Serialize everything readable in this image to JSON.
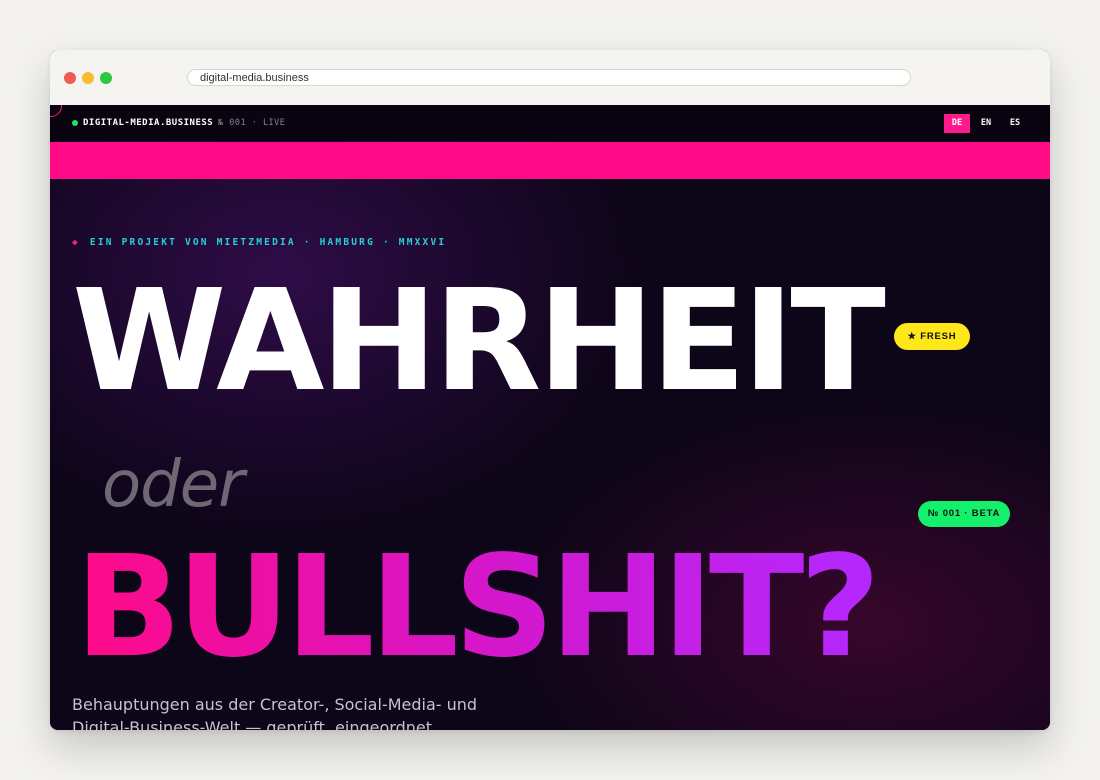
{
  "browser": {
    "url": "digital-media.business"
  },
  "nav": {
    "brand": "DIGITAL-MEDIA.BUSINESS",
    "issue": "№ 001 · LIVE",
    "languages": [
      "DE",
      "EN",
      "ES"
    ],
    "active_language": "DE"
  },
  "hero": {
    "kicker_symbol": "◆",
    "kicker": "EIN PROJEKT VON MIETZMEDIA · HAMBURG · MMXXVI",
    "title_line1": "WAHRHEIT",
    "title_line2": "oder",
    "title_line3": "BULLSHIT?",
    "badge_fresh": "★ FRESH",
    "badge_beta": "№ 001 · BETA",
    "lede": "Behauptungen aus der Creator-, Social-Media- und Digital-Business-Welt — geprüft, eingeordnet."
  },
  "colors": {
    "accent_pink": "#ff0a87",
    "accent_cyan": "#23d1d6",
    "accent_yellow": "#ffe81a",
    "accent_green": "#14f06c",
    "accent_purple": "#b328ff",
    "background": "#0d0518"
  }
}
